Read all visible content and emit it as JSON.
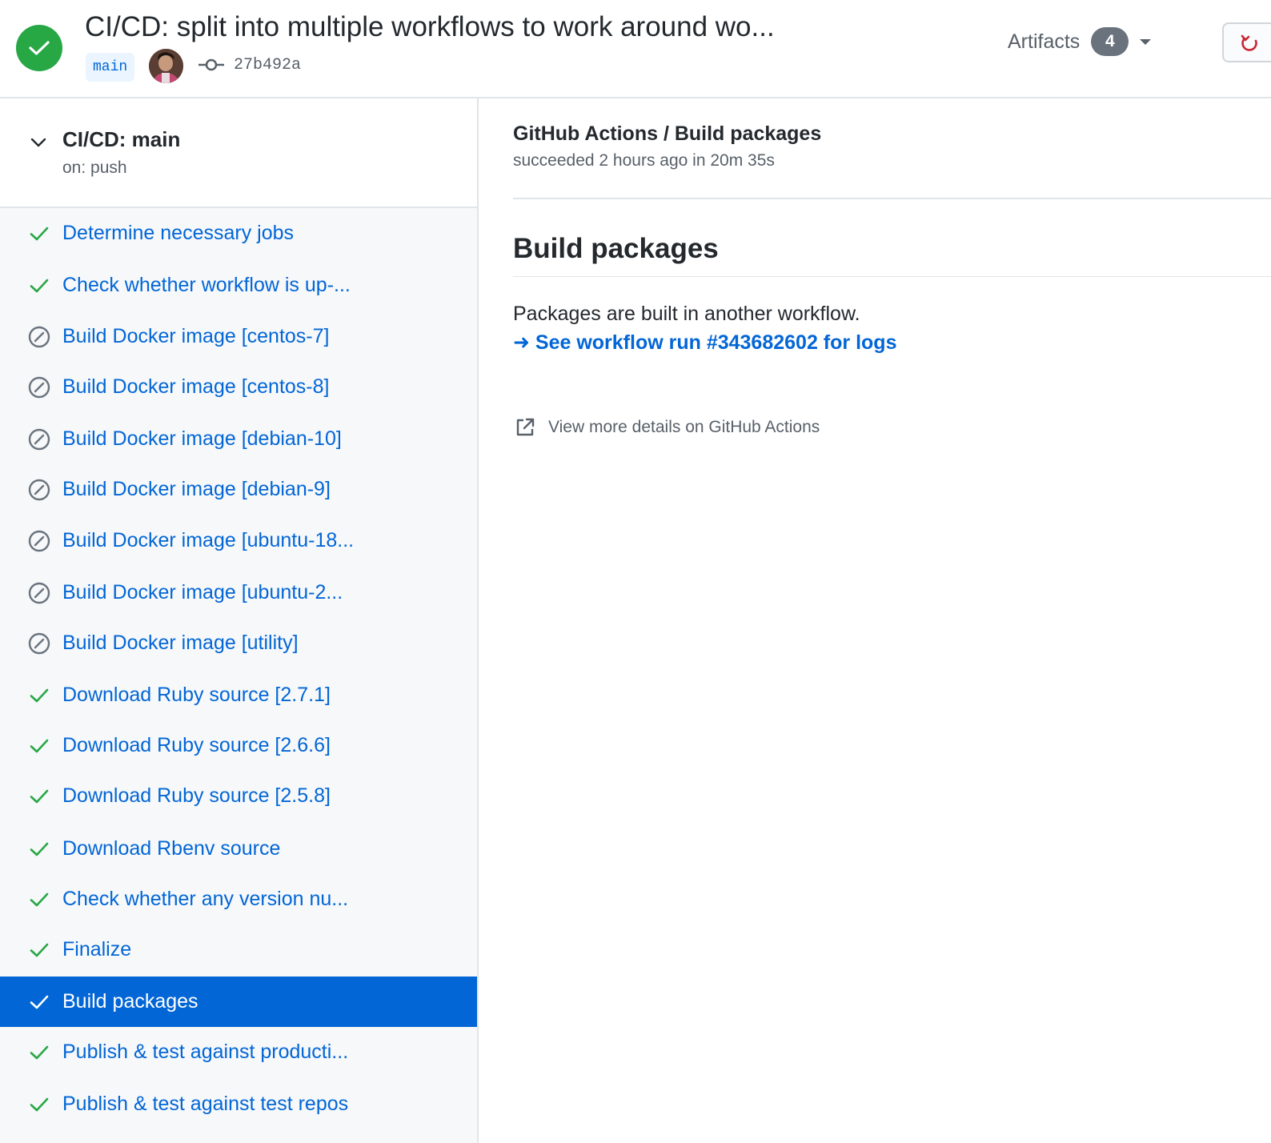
{
  "header": {
    "run_title": "CI/CD: split into multiple workflows to work around wo...",
    "branch": "main",
    "commit_sha": "27b492a",
    "artifacts_label": "Artifacts",
    "artifacts_count": "4",
    "status_color": "#28a745"
  },
  "sidebar": {
    "workflow_title": "CI/CD: main",
    "workflow_trigger": "on: push",
    "jobs": [
      {
        "label": "Determine necessary jobs",
        "status": "success"
      },
      {
        "label": "Check whether workflow is up-...",
        "status": "success"
      },
      {
        "label": "Build Docker image [centos-7]",
        "status": "skipped"
      },
      {
        "label": "Build Docker image [centos-8]",
        "status": "skipped"
      },
      {
        "label": "Build Docker image [debian-10]",
        "status": "skipped"
      },
      {
        "label": "Build Docker image [debian-9]",
        "status": "skipped"
      },
      {
        "label": "Build Docker image [ubuntu-18...",
        "status": "skipped"
      },
      {
        "label": "Build Docker image [ubuntu-2...",
        "status": "skipped"
      },
      {
        "label": "Build Docker image [utility]",
        "status": "skipped"
      },
      {
        "label": "Download Ruby source [2.7.1]",
        "status": "success"
      },
      {
        "label": "Download Ruby source [2.6.6]",
        "status": "success"
      },
      {
        "label": "Download Ruby source [2.5.8]",
        "status": "success"
      },
      {
        "label": "Download Rbenv source",
        "status": "success"
      },
      {
        "label": "Check whether any version nu...",
        "status": "success"
      },
      {
        "label": "Finalize",
        "status": "success"
      },
      {
        "label": "Build packages",
        "status": "success",
        "selected": true
      },
      {
        "label": "Publish & test against producti...",
        "status": "success"
      },
      {
        "label": "Publish & test against test repos",
        "status": "success"
      }
    ]
  },
  "main": {
    "check_title": "GitHub Actions / Build packages",
    "check_status": "succeeded 2 hours ago in 20m 35s",
    "heading": "Build packages",
    "body": "Packages are built in another workflow.",
    "link": "➜ See workflow run #343682602 for logs",
    "details": "View more details on GitHub Actions"
  },
  "colors": {
    "link": "#0366d6",
    "success": "#28a745",
    "skipped": "#6a737d",
    "selected_bg": "#0366d6"
  }
}
